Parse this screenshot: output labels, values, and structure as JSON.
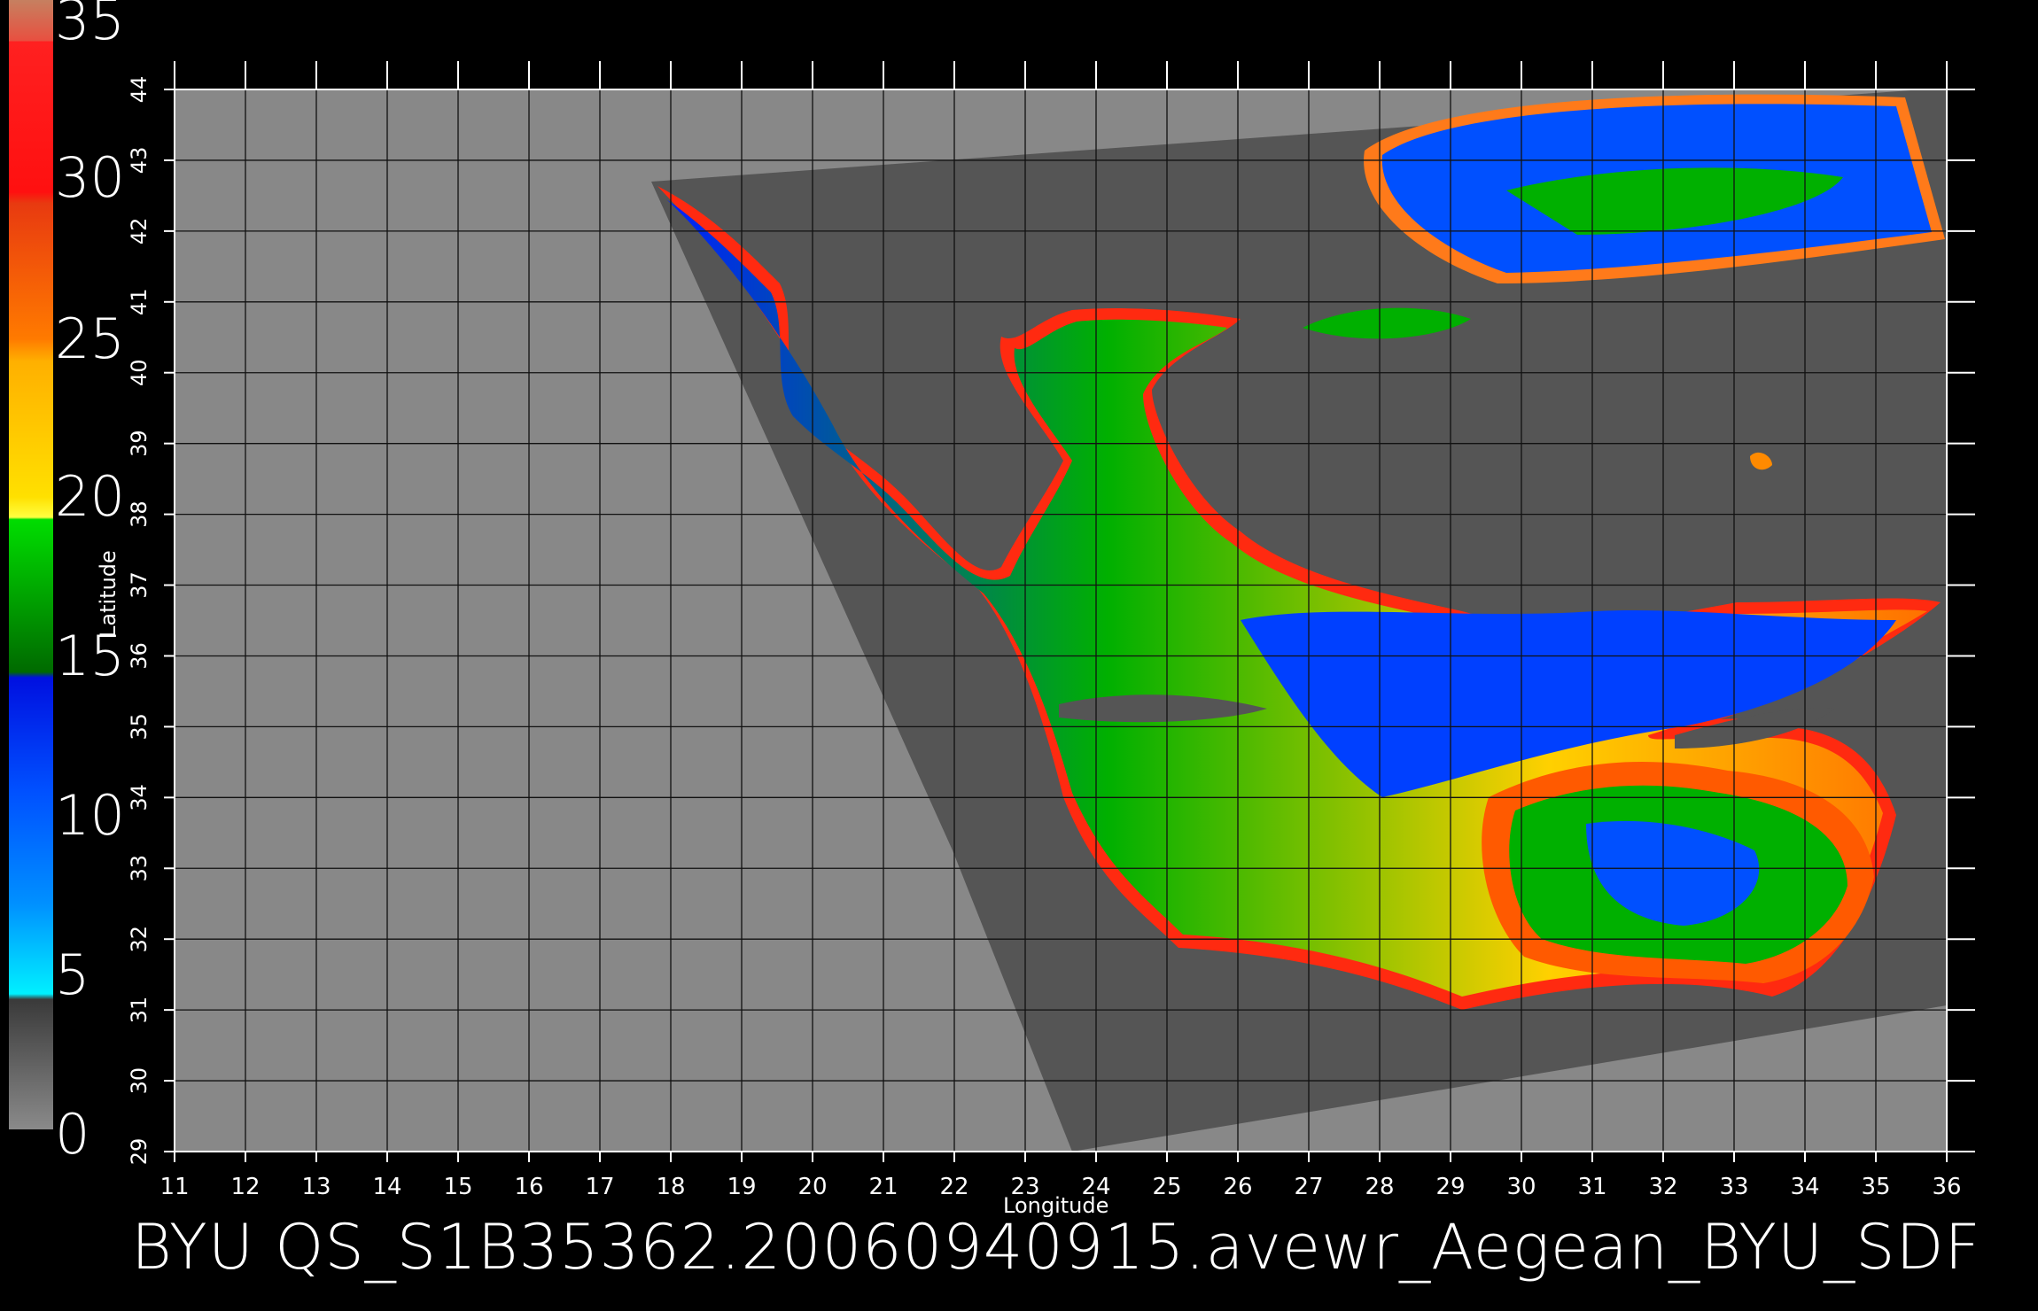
{
  "colorbar": {
    "labels": [
      "35",
      "30",
      "25",
      "20",
      "15",
      "10",
      "5",
      "0"
    ],
    "colors": {
      "top": "#c67f57",
      "red": "#ff1a1a",
      "orange": "#ff6a00",
      "yellow": "#ffe000",
      "green": "#00c000",
      "blue": "#0033ff",
      "cyan": "#00f0ff",
      "gray": "#6a6a6a"
    }
  },
  "map": {
    "x_axis_title": "Longitude",
    "y_axis_title": "Latitude",
    "longitude_ticks": [
      "11",
      "12",
      "13",
      "14",
      "15",
      "16",
      "17",
      "18",
      "19",
      "20",
      "21",
      "22",
      "23",
      "24",
      "25",
      "26",
      "27",
      "28",
      "29",
      "30",
      "31",
      "32",
      "33",
      "34",
      "35",
      "36"
    ],
    "latitude_ticks": [
      "29",
      "30",
      "31",
      "32",
      "33",
      "34",
      "35",
      "36",
      "37",
      "38",
      "39",
      "40",
      "41",
      "42",
      "43",
      "44"
    ],
    "lon_range": [
      11,
      36
    ],
    "lat_range": [
      29,
      44
    ],
    "background_color": "#888888",
    "swath_color": "#555555"
  },
  "footer": {
    "title": "BYU  QS_S1B35362.20060940915.avewr_Aegean_BYU_SDF"
  }
}
